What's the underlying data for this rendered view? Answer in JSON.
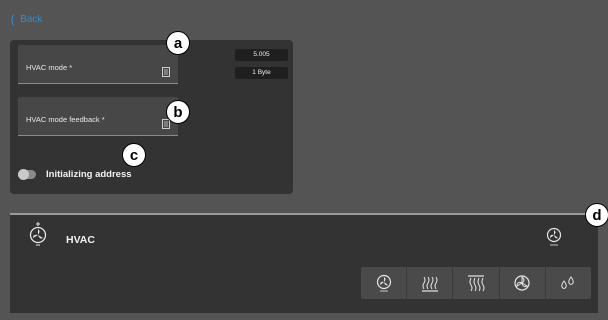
{
  "nav": {
    "back_label": "Back"
  },
  "fields": [
    {
      "label": "HVAC mode *",
      "icon": "document-icon"
    },
    {
      "label": "HVAC mode feedback *",
      "icon": "document-icon"
    }
  ],
  "tags": {
    "address": "5.005",
    "datatype": "1 Byte"
  },
  "toggle": {
    "label": "Initializing address",
    "on": false
  },
  "card": {
    "title": "HVAC",
    "modes": [
      {
        "name": "auto-fan-icon"
      },
      {
        "name": "heat-icon"
      },
      {
        "name": "cool-icon"
      },
      {
        "name": "fan-only-icon"
      },
      {
        "name": "dry-icon"
      }
    ]
  },
  "callouts": {
    "a": "a",
    "b": "b",
    "c": "c",
    "d": "d"
  },
  "colors": {
    "accent": "#2a8fd6",
    "background": "#545454",
    "panel": "#333333"
  }
}
